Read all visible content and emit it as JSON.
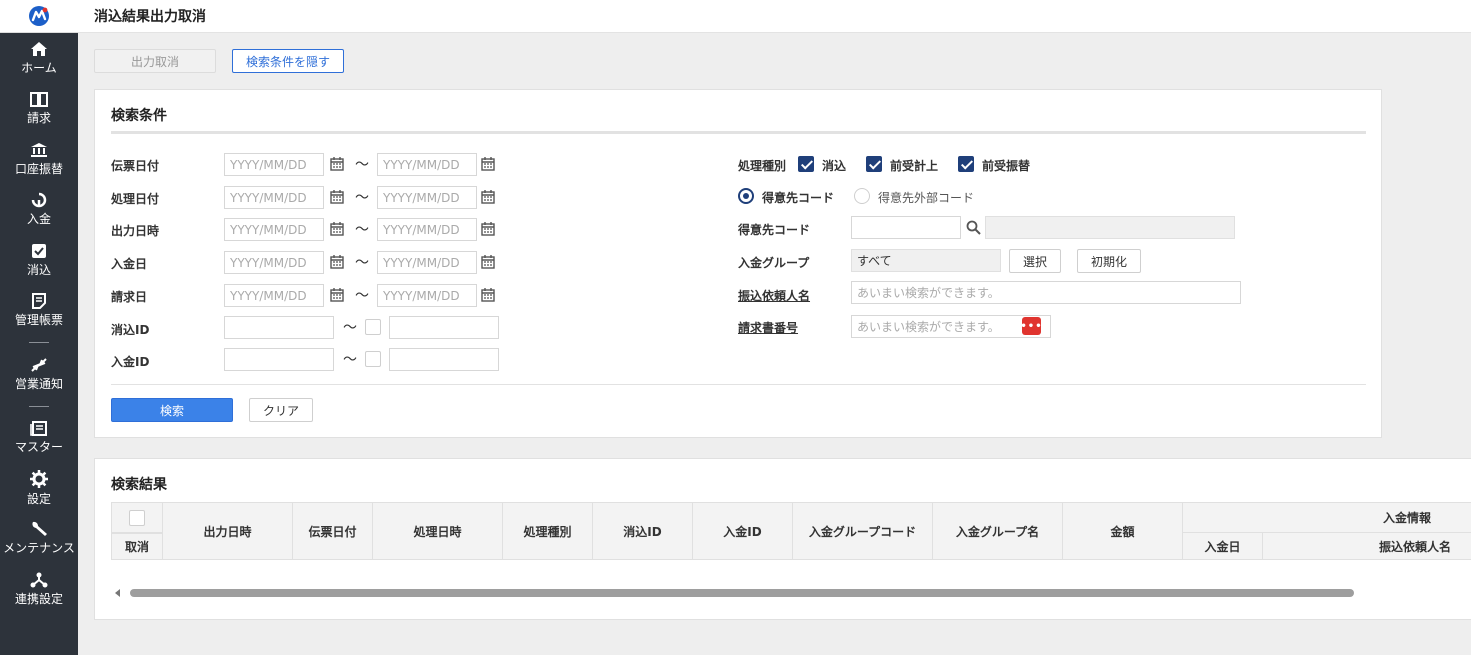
{
  "header": {
    "title": "消込結果出力取消"
  },
  "sidebar": {
    "items": [
      {
        "label": "ホーム",
        "icon": "home-icon"
      },
      {
        "label": "請求",
        "icon": "book-icon"
      },
      {
        "label": "口座振替",
        "icon": "bank-icon"
      },
      {
        "label": "入金",
        "icon": "deposit-icon"
      },
      {
        "label": "消込",
        "icon": "check-box-icon"
      },
      {
        "label": "管理帳票",
        "icon": "report-icon"
      },
      {
        "label": "営業通知",
        "icon": "notify-icon"
      },
      {
        "label": "マスター",
        "icon": "master-icon"
      },
      {
        "label": "設定",
        "icon": "gear-icon"
      },
      {
        "label": "メンテナンス",
        "icon": "wrench-icon"
      },
      {
        "label": "連携設定",
        "icon": "link-icon"
      }
    ]
  },
  "toolbar": {
    "cancel_output": "出力取消",
    "hide_conditions": "検索条件を隠す"
  },
  "search": {
    "title": "検索条件",
    "date_placeholder": "YYYY/MM/DD",
    "tilde": "～",
    "fields": {
      "voucher_date": "伝票日付",
      "process_date": "処理日付",
      "output_datetime": "出力日時",
      "deposit_date": "入金日",
      "billing_date": "請求日",
      "reconcile_id": "消込ID",
      "deposit_id": "入金ID"
    },
    "process_type": {
      "label": "処理種別",
      "options": [
        "消込",
        "前受計上",
        "前受振替"
      ]
    },
    "customer_code_type": {
      "options": [
        "得意先コード",
        "得意先外部コード"
      ]
    },
    "customer_code": {
      "label": "得意先コード"
    },
    "deposit_group": {
      "label": "入金グループ",
      "value": "すべて",
      "select": "選択",
      "reset": "初期化"
    },
    "transfer_requester": {
      "label": "振込依頼人名",
      "placeholder": "あいまい検索ができます。"
    },
    "invoice_number": {
      "label": "請求書番号",
      "placeholder": "あいまい検索ができます。"
    },
    "search_button": "検索",
    "clear_button": "クリア"
  },
  "results": {
    "title": "検索結果",
    "columns": {
      "cancel": "取消",
      "output_datetime": "出力日時",
      "voucher_date": "伝票日付",
      "process_datetime": "処理日時",
      "process_type": "処理種別",
      "reconcile_id": "消込ID",
      "deposit_id": "入金ID",
      "group_code": "入金グループコード",
      "group_name": "入金グループ名",
      "amount": "金額",
      "deposit_info": "入金情報",
      "deposit_date": "入金日",
      "requester_name": "振込依頼人名"
    }
  },
  "colors": {
    "sidebar_bg": "#2d333b",
    "accent": "#3b82e8",
    "check": "#1f3f7a",
    "brand_red": "#e0342f"
  }
}
